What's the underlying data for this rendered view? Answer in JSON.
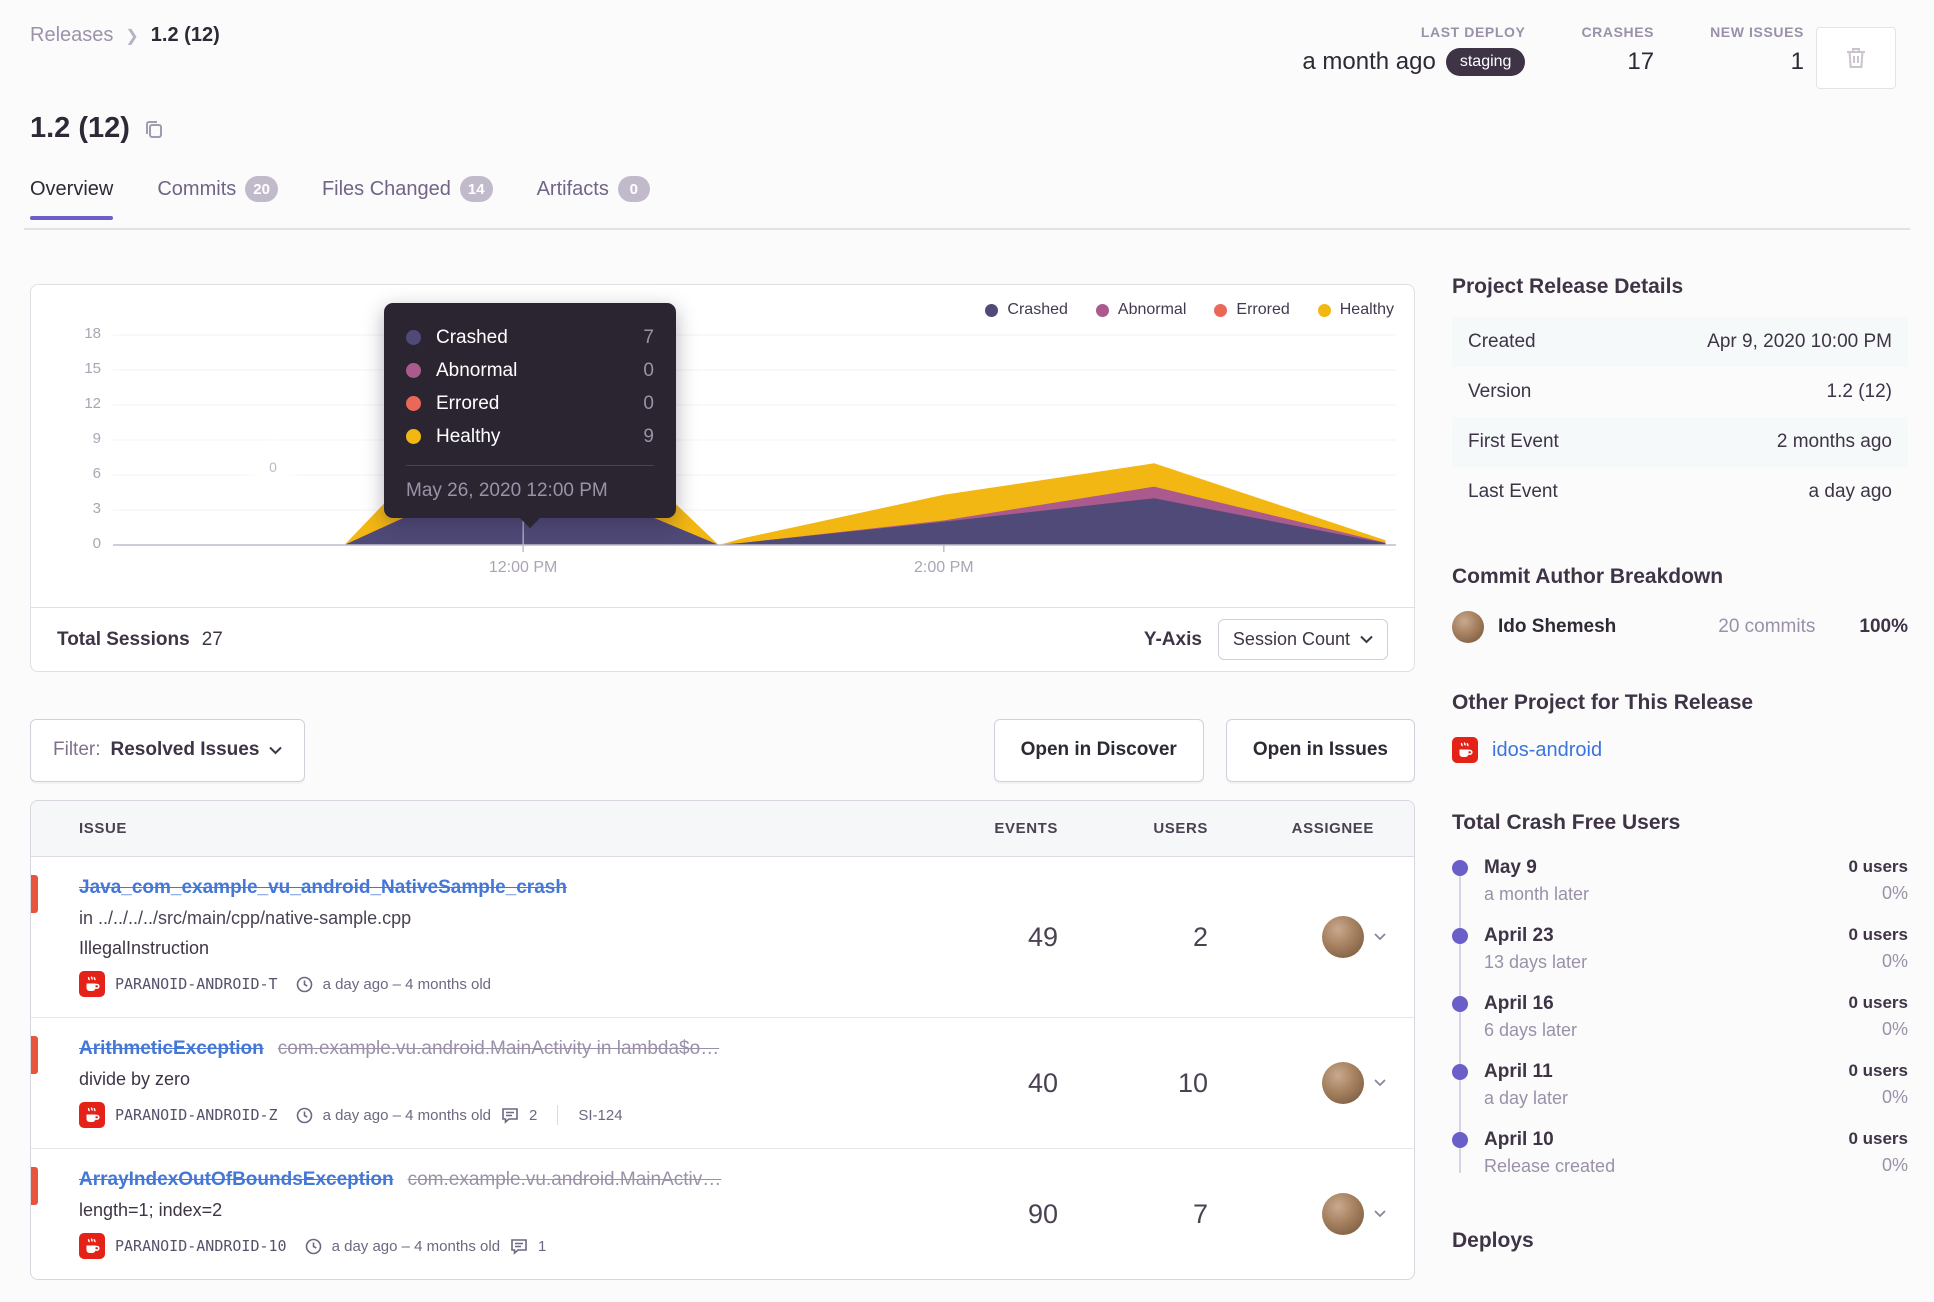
{
  "colors": {
    "accent_purple": "#6C5FC7",
    "link_blue": "#3C74DD",
    "error_red": "#E8553E",
    "badge_dark": "#3E3446"
  },
  "breadcrumb": {
    "items": [
      "Releases",
      "1.2 (12)"
    ]
  },
  "topstats": [
    {
      "label": "LAST DEPLOY",
      "value": "a month ago",
      "badge": "staging"
    },
    {
      "label": "CRASHES",
      "value": "17"
    },
    {
      "label": "NEW ISSUES",
      "value": "1"
    }
  ],
  "page_title": "1.2 (12)",
  "tabs": [
    {
      "label": "Overview",
      "active": true
    },
    {
      "label": "Commits",
      "count": "20"
    },
    {
      "label": "Files Changed",
      "count": "14"
    },
    {
      "label": "Artifacts",
      "count": "0"
    }
  ],
  "chart_data": {
    "type": "area",
    "stacked": true,
    "title": "Release sessions over time",
    "x_unit": "hour_of_day",
    "x_domain": [
      10.05,
      16.15
    ],
    "x_ticks": [
      {
        "value": 12,
        "label": "12:00 PM"
      },
      {
        "value": 14,
        "label": "2:00 PM"
      }
    ],
    "ylim": [
      0,
      18
    ],
    "y_ticks": [
      0,
      3,
      6,
      9,
      12,
      15,
      18
    ],
    "grid": true,
    "legend_position": "top-right",
    "x": [
      10.05,
      11.15,
      12.0,
      12.93,
      13.05,
      14.0,
      15.0,
      16.1
    ],
    "series": [
      {
        "name": "Crashed",
        "color": "#4F4A77",
        "values": [
          0,
          0,
          7,
          0,
          0.2,
          2.0,
          4,
          0.15
        ]
      },
      {
        "name": "Abnormal",
        "color": "#AA5A8C",
        "values": [
          0,
          0,
          0,
          0,
          0,
          0.1,
          1,
          0.05
        ]
      },
      {
        "name": "Errored",
        "color": "#EA6857",
        "values": [
          0,
          0,
          0,
          0,
          0,
          0,
          0,
          0
        ]
      },
      {
        "name": "Healthy",
        "color": "#F2B712",
        "values": [
          0,
          0,
          9,
          0,
          0.4,
          2.2,
          2,
          0.2
        ]
      }
    ],
    "annotation_zero_label": "0"
  },
  "tooltip": {
    "rows": [
      {
        "label": "Crashed",
        "value": "7"
      },
      {
        "label": "Abnormal",
        "value": "0"
      },
      {
        "label": "Errored",
        "value": "0"
      },
      {
        "label": "Healthy",
        "value": "9"
      }
    ],
    "footer": "May 26, 2020 12:00 PM"
  },
  "chart_footer": {
    "sessions_label": "Total Sessions",
    "sessions_value": "27",
    "yaxis_label": "Y-Axis",
    "yaxis_button": "Session Count"
  },
  "filter_bar": {
    "filter_prefix": "Filter:",
    "filter_value": "Resolved Issues",
    "discover_button": "Open in Discover",
    "issues_button": "Open in Issues"
  },
  "issues_table": {
    "columns": [
      "ISSUE",
      "EVENTS",
      "USERS",
      "ASSIGNEE"
    ],
    "rows": [
      {
        "title": "Java_com_example_vu_android_NativeSample_crash",
        "culprit": "",
        "subtitle": "in ../../../../src/main/cpp/native-sample.cpp",
        "message": "IllegalInstruction",
        "project": "PARANOID-ANDROID-T",
        "age": "a day ago – 4 months old",
        "comments": "",
        "short_id": "",
        "events": "49",
        "users": "2"
      },
      {
        "title": "ArithmeticException",
        "culprit": "com.example.vu.android.MainActivity in lambda$o…",
        "subtitle": "",
        "message": "divide by zero",
        "project": "PARANOID-ANDROID-Z",
        "age": "a day ago – 4 months old",
        "comments": "2",
        "short_id": "SI-124",
        "events": "40",
        "users": "10"
      },
      {
        "title": "ArrayIndexOutOfBoundsException",
        "culprit": "com.example.vu.android.MainActiv…",
        "subtitle": "",
        "message": "length=1; index=2",
        "project": "PARANOID-ANDROID-10",
        "age": "a day ago – 4 months old",
        "comments": "1",
        "short_id": "",
        "events": "90",
        "users": "7"
      }
    ]
  },
  "sidebar": {
    "details": {
      "heading": "Project Release Details",
      "rows": [
        [
          "Created",
          "Apr 9, 2020 10:00 PM"
        ],
        [
          "Version",
          "1.2 (12)"
        ],
        [
          "First Event",
          "2 months ago"
        ],
        [
          "Last Event",
          "a day ago"
        ]
      ]
    },
    "authors": {
      "heading": "Commit Author Breakdown",
      "rows": [
        {
          "name": "Ido Shemesh",
          "commits": "20 commits",
          "percent": "100%"
        }
      ]
    },
    "other_project": {
      "heading": "Other Project for This Release",
      "link": "idos-android"
    },
    "crash_free": {
      "heading": "Total Crash Free Users",
      "items": [
        {
          "date": "May 9",
          "sub": "a month later",
          "users": "0 users",
          "percent": "0%"
        },
        {
          "date": "April 23",
          "sub": "13 days later",
          "users": "0 users",
          "percent": "0%"
        },
        {
          "date": "April 16",
          "sub": "6 days later",
          "users": "0 users",
          "percent": "0%"
        },
        {
          "date": "April 11",
          "sub": "a day later",
          "users": "0 users",
          "percent": "0%"
        },
        {
          "date": "April 10",
          "sub": "Release created",
          "users": "0 users",
          "percent": "0%"
        }
      ]
    },
    "deploys_heading": "Deploys"
  }
}
